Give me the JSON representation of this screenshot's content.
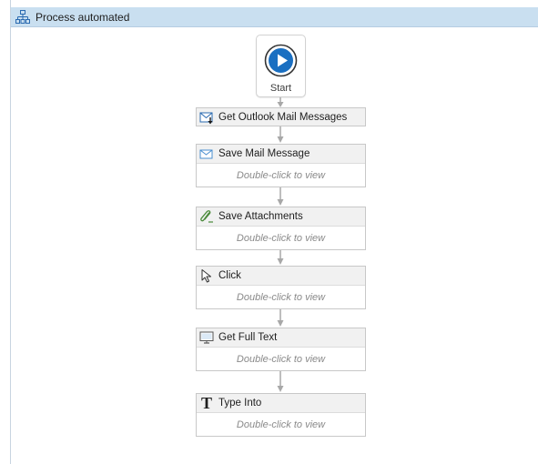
{
  "header": {
    "title": "Process automated",
    "icon": "workflow-tree-icon",
    "background": "#c9dff0"
  },
  "start": {
    "label": "Start",
    "icon": "play-circle-icon",
    "accent": "#1a6fc1"
  },
  "activities": [
    {
      "name": "Get Outlook Mail Messages",
      "icon": "mail-download-icon",
      "body": ""
    },
    {
      "name": "Save Mail Message",
      "icon": "mail-open-icon",
      "body": "Double-click to view"
    },
    {
      "name": "Save Attachments",
      "icon": "paperclip-icon",
      "body": "Double-click to view"
    },
    {
      "name": "Click",
      "icon": "cursor-icon",
      "body": "Double-click to view"
    },
    {
      "name": "Get Full Text",
      "icon": "monitor-icon",
      "body": "Double-click to view"
    },
    {
      "name": "Type Into",
      "icon": "text-t-icon",
      "body": "Double-click to view"
    }
  ]
}
